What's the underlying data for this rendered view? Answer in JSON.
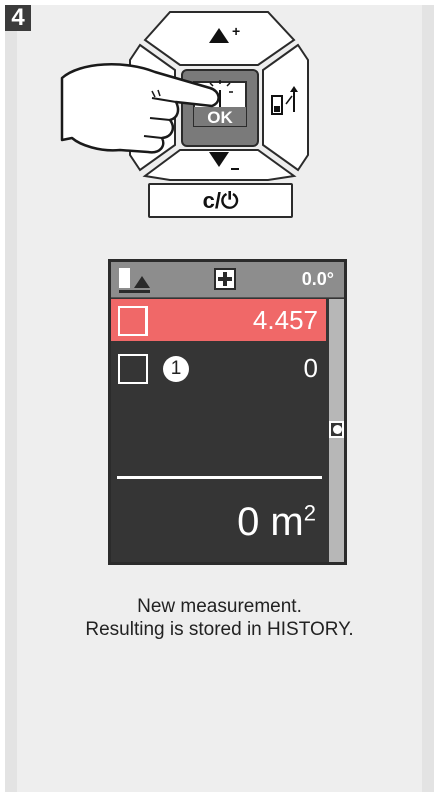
{
  "step": {
    "number": "4"
  },
  "keypad": {
    "up_label": "▲+",
    "down_label": "▼-",
    "ok_label": "OK",
    "clear_label": "c/⏻"
  },
  "display": {
    "tilt_value": "0.0°",
    "rows": [
      {
        "value": "4.457"
      },
      {
        "marker": "1",
        "value": "0"
      }
    ],
    "area_value": "0 m",
    "area_exponent": "2"
  },
  "caption": {
    "line1": "New measurement.",
    "line2": "Resulting is stored in HISTORY."
  }
}
